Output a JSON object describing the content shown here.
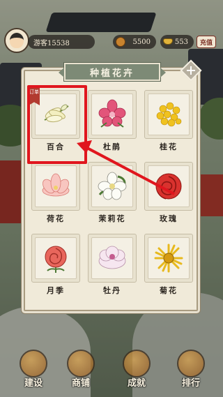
{
  "hud": {
    "player_name": "游客15538",
    "coins": "5500",
    "ingots": "553",
    "recharge_label": "充值"
  },
  "modal": {
    "title": "种植花卉",
    "close_icon": "close-icon"
  },
  "flowers": [
    {
      "label": "百合",
      "icon": "lily-icon",
      "tag": "订单",
      "color": "#f2f0c8"
    },
    {
      "label": "杜鹃",
      "icon": "azalea-icon",
      "color": "#e2557a"
    },
    {
      "label": "桂花",
      "icon": "osmanthus-icon",
      "color": "#f0c21f"
    },
    {
      "label": "荷花",
      "icon": "lotus-icon",
      "color": "#f4a7a0"
    },
    {
      "label": "茉莉花",
      "icon": "jasmine-icon",
      "color": "#fbfbf5"
    },
    {
      "label": "玫瑰",
      "icon": "rose-icon",
      "color": "#d9322e"
    },
    {
      "label": "月季",
      "icon": "chinese-rose-icon",
      "color": "#e8665c"
    },
    {
      "label": "牡丹",
      "icon": "peony-icon",
      "color": "#f3dceb"
    },
    {
      "label": "菊花",
      "icon": "chrysanthemum-icon",
      "color": "#e7b91e"
    }
  ],
  "bottom_nav": [
    {
      "label": "建设",
      "icon": "build-icon"
    },
    {
      "label": "商铺",
      "icon": "shop-icon"
    },
    {
      "label": "成就",
      "icon": "achievement-icon"
    },
    {
      "label": "排行",
      "icon": "ranking-icon"
    }
  ],
  "colors": {
    "highlight": "#e0161e",
    "panel": "#f0ead9",
    "title_bar": "#7d8a76"
  }
}
